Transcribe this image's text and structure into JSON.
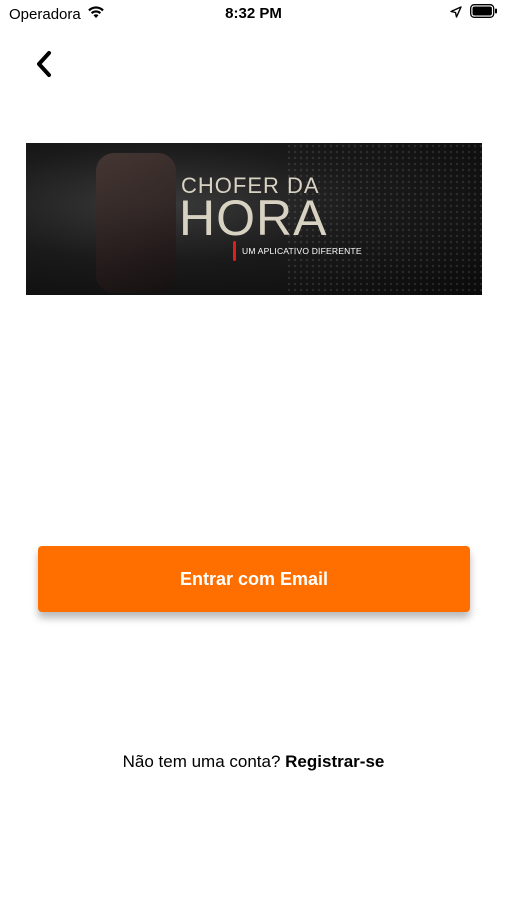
{
  "status_bar": {
    "carrier": "Operadora",
    "time": "8:32 PM",
    "icons": [
      "wifi-icon",
      "location-arrow-icon",
      "battery-icon"
    ]
  },
  "nav": {
    "back_icon": "chevron-left-icon"
  },
  "banner": {
    "line1": "CHOFER DA",
    "line2": "HORA",
    "subtitle": "UM APLICATIVO DIFERENTE",
    "accent_color": "#e11d1d"
  },
  "login": {
    "button_label": "Entrar com Email",
    "button_color": "#ff6f00"
  },
  "register": {
    "prompt": "Não tem uma conta?",
    "link": "Registrar-se"
  }
}
